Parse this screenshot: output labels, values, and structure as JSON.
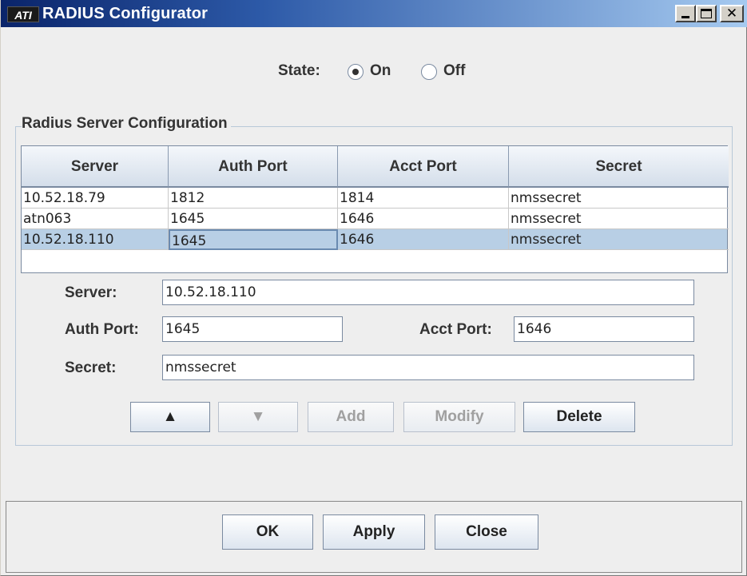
{
  "window": {
    "title": "RADIUS Configurator",
    "app_icon_text": "ATI",
    "controls": {
      "minimize": "_",
      "maximize": "□",
      "close": "✕"
    }
  },
  "state": {
    "label": "State:",
    "options": [
      {
        "label": "On",
        "selected": true
      },
      {
        "label": "Off",
        "selected": false
      }
    ]
  },
  "group": {
    "title": "Radius Server Configuration"
  },
  "table": {
    "columns": [
      "Server",
      "Auth Port",
      "Acct Port",
      "Secret"
    ],
    "rows": [
      [
        "10.52.18.79",
        "1812",
        "1814",
        "nmssecret"
      ],
      [
        "atn063",
        "1645",
        "1646",
        "nmssecret"
      ],
      [
        "10.52.18.110",
        "1645",
        "1646",
        "nmssecret"
      ]
    ],
    "selected_row": 2
  },
  "form": {
    "server_label": "Server:",
    "server_value": "10.52.18.110",
    "auth_port_label": "Auth Port:",
    "auth_port_value": "1645",
    "acct_port_label": "Acct Port:",
    "acct_port_value": "1646",
    "secret_label": "Secret:",
    "secret_value": "nmssecret"
  },
  "actions": {
    "up": "▲",
    "down": "▼",
    "add": "Add",
    "modify": "Modify",
    "delete": "Delete"
  },
  "footer": {
    "ok": "OK",
    "apply": "Apply",
    "close": "Close"
  },
  "colors": {
    "title_gradient_start": "#0a246a",
    "title_gradient_end": "#a6caf0",
    "selection": "#b8cfe5",
    "background": "#eeeeee"
  }
}
